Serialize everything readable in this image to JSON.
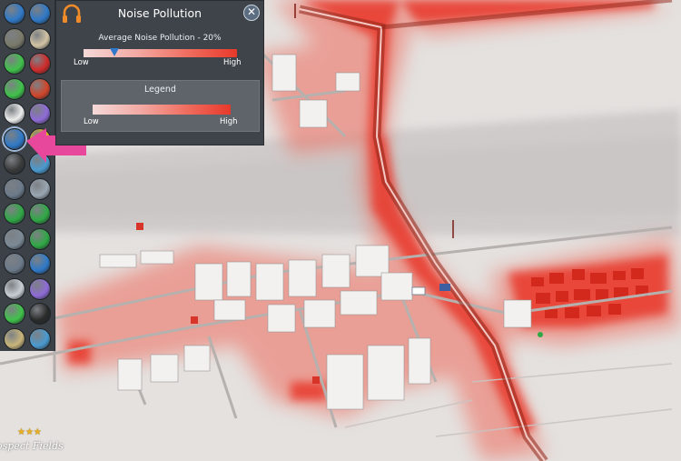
{
  "panel": {
    "title": "Noise Pollution",
    "average_label": "Average Noise Pollution - 20%",
    "average_value_pct": 20,
    "slider_low": "Low",
    "slider_high": "High",
    "legend_title": "Legend",
    "legend_low": "Low",
    "legend_high": "High",
    "close_icon": "close-icon",
    "header_icon": "headphones-icon"
  },
  "map": {
    "district_name": "ospect Fields",
    "district_stars": "★★★",
    "heat_color": "#e8392b",
    "ground_color": "#e4e1df",
    "river_color": "#cdcac9"
  },
  "sidebar": {
    "tools": [
      {
        "icon": "pencil-icon",
        "color": "#2f79c8"
      },
      {
        "icon": "water-drop-icon",
        "color": "#2f79c8"
      },
      {
        "icon": "garbage-icon",
        "color": "#7a7a6a"
      },
      {
        "icon": "box-icon",
        "color": "#d2c3a4"
      },
      {
        "icon": "happiness-icon",
        "color": "#3fc24a"
      },
      {
        "icon": "health-heart-icon",
        "color": "#d02a2a"
      },
      {
        "icon": "star-icon",
        "color": "#3fc24a"
      },
      {
        "icon": "fire-icon",
        "color": "#d1452a"
      },
      {
        "icon": "police-car-icon",
        "color": "#ededed"
      },
      {
        "icon": "education-icon",
        "color": "#8e6bd6"
      },
      {
        "icon": "noise-headphones-icon",
        "color": "#2f79c8"
      },
      {
        "icon": "sun-icon",
        "color": "#e3b823"
      },
      {
        "icon": "crime-mask-icon",
        "color": "#3a3a3a"
      },
      {
        "icon": "transport-icon",
        "color": "#4a9ad0"
      },
      {
        "icon": "person-icon",
        "color": "#6c7a8a"
      },
      {
        "icon": "building-icon",
        "color": "#9aa6b2"
      },
      {
        "icon": "money-icon",
        "color": "#2fa845"
      },
      {
        "icon": "leaf-icon",
        "color": "#2fa845"
      },
      {
        "icon": "wind-icon",
        "color": "#7c8a96"
      },
      {
        "icon": "tree-icon",
        "color": "#2fa845"
      },
      {
        "icon": "ground-icon",
        "color": "#6c7a8a"
      },
      {
        "icon": "list-icon",
        "color": "#2f79c8"
      },
      {
        "icon": "lock-icon",
        "color": "#c9ced4"
      },
      {
        "icon": "grid-icon",
        "color": "#8e6bd6"
      },
      {
        "icon": "tools-icon",
        "color": "#3fc24a"
      },
      {
        "icon": "more-icon",
        "color": "#2a2a2a"
      },
      {
        "icon": "mail-icon",
        "color": "#c9b57a"
      },
      {
        "icon": "fish-icon",
        "color": "#4a9ad0"
      }
    ]
  }
}
